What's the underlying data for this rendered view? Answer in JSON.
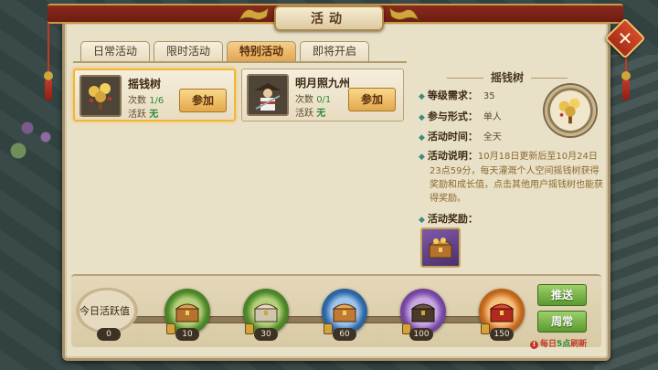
{
  "window": {
    "title": "活动",
    "close_symbol": "✕"
  },
  "tabs": [
    {
      "label": "日常活动",
      "active": false
    },
    {
      "label": "限时活动",
      "active": false
    },
    {
      "label": "特别活动",
      "active": true
    },
    {
      "label": "即将开启",
      "active": false
    }
  ],
  "activities": [
    {
      "name": "摇钱树",
      "count_label": "次数",
      "count_value": "1/6",
      "active_label": "活跃",
      "active_value": "无",
      "join_label": "参加",
      "icon": "money-tree-icon",
      "selected": true
    },
    {
      "name": "明月照九州",
      "count_label": "次数",
      "count_value": "0/1",
      "active_label": "活跃",
      "active_value": "无",
      "join_label": "参加",
      "icon": "swordsman-portrait-icon",
      "selected": false
    }
  ],
  "detail": {
    "title": "摇钱树",
    "icon": "money-tree-icon",
    "level_label": "等级需求：",
    "level_value": "35",
    "mode_label": "参与形式：",
    "mode_value": "单人",
    "time_label": "活动时间：",
    "time_value": "全天",
    "desc_label": "活动说明：",
    "desc_text": "10月18日更新后至10月24日23点59分，每天灌溉个人空间摇钱树获得奖励和成长值，点击其他用户摇钱树也能获得奖励。",
    "reward_label": "活动奖励：",
    "reward_icon": "treasure-chest-icon"
  },
  "daily_activity": {
    "label": "今日活跃值",
    "current": "0",
    "milestones": [
      {
        "value": "10",
        "color": "green"
      },
      {
        "value": "30",
        "color": "green"
      },
      {
        "value": "60",
        "color": "blue"
      },
      {
        "value": "100",
        "color": "purple"
      },
      {
        "value": "150",
        "color": "orange"
      }
    ]
  },
  "buttons": {
    "push": "推送",
    "weekly": "周常"
  },
  "refresh_note": {
    "before": "每日",
    "highlight": "5点",
    "after": "刷新"
  },
  "colors": {
    "accent": "#e2a652",
    "panel": "#e9e0c8",
    "green_text": "#2e8b3a",
    "red": "#c0392b"
  }
}
